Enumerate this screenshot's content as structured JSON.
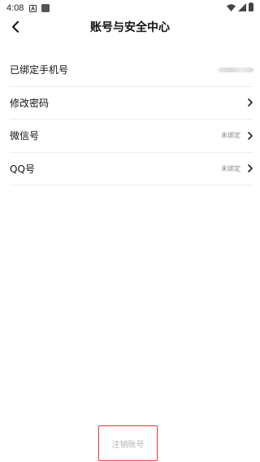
{
  "status": {
    "time": "4:08",
    "notif_icon": "notification-a-icon",
    "app_icon": "square-app-icon",
    "wifi_icon": "wifi-icon",
    "signal_icon": "signal-icon",
    "battery_icon": "battery-icon"
  },
  "header": {
    "title": "账号与安全中心",
    "back_icon": "chevron-left-icon"
  },
  "rows": [
    {
      "label": "已绑定手机号",
      "value": "",
      "masked": true
    },
    {
      "label": "修改密码",
      "value": ""
    },
    {
      "label": "微信号",
      "value": "未绑定"
    },
    {
      "label": "QQ号",
      "value": "未绑定"
    }
  ],
  "footer": {
    "cancel_label": "注销账号",
    "highlight_color": "#e53935"
  }
}
